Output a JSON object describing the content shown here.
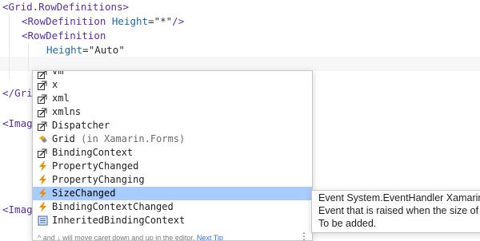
{
  "editor": {
    "lines": [
      {
        "open": "<",
        "tag": "Grid.RowDefinitions",
        "close": ">"
      },
      {
        "open": "<",
        "tag": "RowDefinition",
        "attr": "Height",
        "eq": "=",
        "value": "\"*\"",
        "close": "/>"
      },
      {
        "open": "<",
        "tag": "RowDefinition"
      },
      {
        "attr": "Height",
        "eq": "=",
        "value": "\"Auto\""
      },
      {
        "text": ""
      },
      {
        "open": "</",
        "tag": "Grid"
      },
      {
        "open": "<",
        "tag": "Image"
      },
      {
        "open": "<",
        "tag": "Image"
      }
    ]
  },
  "completion": {
    "items": [
      {
        "label": "vm",
        "icon": "namespace-icon"
      },
      {
        "label": "x",
        "icon": "namespace-icon"
      },
      {
        "label": "xml",
        "icon": "namespace-icon"
      },
      {
        "label": "xmlns",
        "icon": "namespace-icon"
      },
      {
        "label": "Dispatcher",
        "icon": "property-icon"
      },
      {
        "label": "Grid",
        "suffix": "(in Xamarin.Forms)",
        "icon": "attached-property-icon"
      },
      {
        "label": "BindingContext",
        "icon": "property-icon"
      },
      {
        "label": "PropertyChanged",
        "icon": "event-icon"
      },
      {
        "label": "PropertyChanging",
        "icon": "event-icon"
      },
      {
        "label": "SizeChanged",
        "icon": "event-icon",
        "selected": true
      },
      {
        "label": "BindingContextChanged",
        "icon": "event-icon"
      },
      {
        "label": "InheritedBindingContext",
        "icon": "method-icon"
      }
    ],
    "footer": {
      "text": "^ and ↓ will move caret down and up in the editor.",
      "link": "Next Tip",
      "more": "⋮"
    }
  },
  "tooltip": {
    "lines": [
      "Event System.EventHandler Xamarin.",
      "Event that is raised when the size of",
      "To be added."
    ]
  },
  "colors": {
    "tag": "#5a2ea6",
    "attribute": "#1f6aa5",
    "selection": "#a9ccff",
    "event_icon": "#f08c00"
  }
}
